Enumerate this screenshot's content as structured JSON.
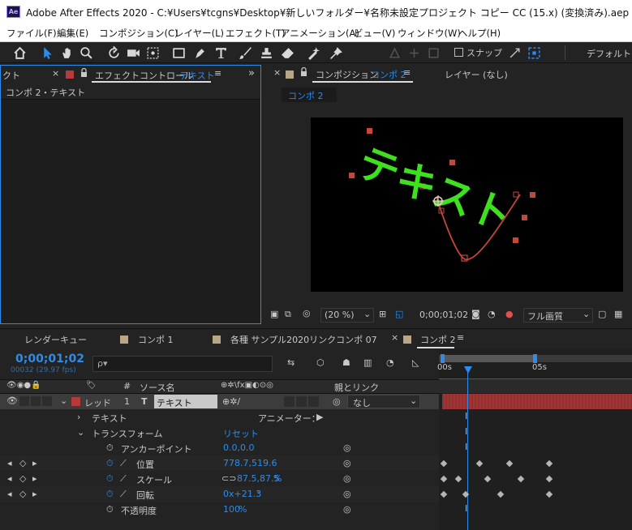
{
  "window": {
    "app_logo": "Ae",
    "title": "Adobe After Effects 2020 - C:¥Users¥tcgns¥Desktop¥新しいフォルダー¥名称未設定プロジェクト コピー  CC (15.x) (変換済み).aep *"
  },
  "menu": {
    "items": [
      {
        "label": "ファイル(F)"
      },
      {
        "label": "編集(E)"
      },
      {
        "label": "コンポジション(C)"
      },
      {
        "label": "レイヤー(L)"
      },
      {
        "label": "エフェクト(T)"
      },
      {
        "label": "アニメーション(A)"
      },
      {
        "label": "ビュー(V)"
      },
      {
        "label": "ウィンドウ(W)"
      },
      {
        "label": "ヘルプ(H)"
      }
    ]
  },
  "toolbar": {
    "tools": [
      "home-icon",
      "selection-tool-icon",
      "hand-tool-icon",
      "zoom-tool-icon",
      "rotate-tool-icon",
      "camera-tool-icon",
      "pan-behind-tool-icon",
      "rectangle-tool-icon",
      "pen-tool-icon",
      "type-tool-icon",
      "brush-tool-icon",
      "clone-stamp-tool-icon",
      "eraser-tool-icon",
      "roto-brush-tool-icon",
      "puppet-pin-tool-icon"
    ],
    "snap_label": "スナップ",
    "workspace_label": "デフォルト"
  },
  "left_panel": {
    "cut_tab_label": "クト",
    "tab_prefix": "エフェクトコントロール",
    "tab_target": "テキスト",
    "subtitle": "コンポ 2・テキスト"
  },
  "comp_panel": {
    "tab_prefix": "コンポジション",
    "tab_comp": "コンポ 2",
    "layer_tab": "レイヤー (なし)",
    "comp_chip": "コンポ 2",
    "viewer_text": "テキスト",
    "zoom": "(20 %)",
    "timecode": "0;00;01;02",
    "quality": "フル画質"
  },
  "timeline_tabs": [
    {
      "label": "レンダーキュー"
    },
    {
      "label": "コンポ 1"
    },
    {
      "label": "各種 サンプル2020リンクコンポ 07"
    },
    {
      "label": "コンポ 2"
    }
  ],
  "timeline": {
    "timecode": "0;00;01;02",
    "frame_info": "00032 (29.97 fps)",
    "search_placeholder": "ρ▾",
    "ruler": {
      "start": "00s",
      "mark": "05s"
    },
    "headers": {
      "number": "#",
      "source_name": "ソース名",
      "switches": "⊕✲\\fx▣◐⊙◎",
      "parent": "親とリンク"
    },
    "layer": {
      "label_color_name": "レッド",
      "number": "1",
      "type_icon": "T",
      "name": "テキスト",
      "parent_value": "なし"
    },
    "properties": {
      "text_group": "テキスト",
      "animator_label": "アニメーター：",
      "transform_group": "トランスフォーム",
      "reset_label": "リセット",
      "anchor_label": "アンカーポイント",
      "anchor_value": "0.0,0.0",
      "position_label": "位置",
      "position_value": "778.7,519.6",
      "scale_label": "スケール",
      "scale_value": "87.5,87.5",
      "scale_unit": "%",
      "rotation_label": "回転",
      "rotation_value": "0x+21.3",
      "rotation_unit": "°",
      "opacity_label": "不透明度",
      "opacity_value": "100",
      "opacity_unit": "%"
    }
  },
  "colors": {
    "accent_blue": "#2d8ceb",
    "text_green": "#3fe01f",
    "layer_red": "#b63a3a",
    "motion_path": "#c4473a"
  }
}
